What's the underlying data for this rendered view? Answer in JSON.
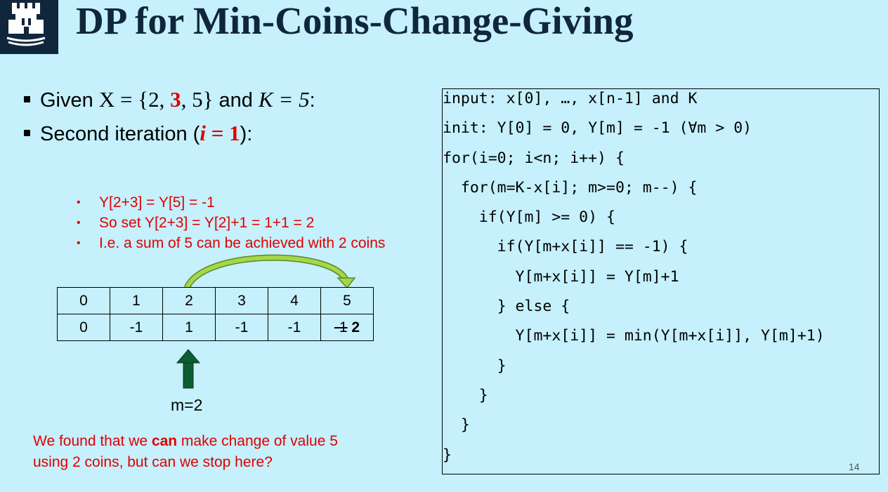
{
  "header": {
    "title": "DP for Min-Coins-Change-Giving"
  },
  "bullets": {
    "b1": {
      "lead": "Given ",
      "set_open": "X = {2, ",
      "set_red": "3",
      "set_close": ", 5}",
      "mid": " and ",
      "k": "K = 5",
      "end": ":"
    },
    "b2": {
      "lead": "Second iteration (",
      "i_var": "i",
      "i_rest": " = 1",
      "end": "):"
    }
  },
  "sub_bullets": [
    {
      "bullet": "•",
      "text": "Y[2+3] = Y[5] = -1"
    },
    {
      "bullet": "•",
      "text": "So set Y[2+3] = Y[2]+1 = 1+1 = 2"
    },
    {
      "bullet": "•",
      "text": "I.e. a sum of 5 can be achieved with 2 coins"
    }
  ],
  "array": {
    "indices": [
      "0",
      "1",
      "2",
      "3",
      "4",
      "5"
    ],
    "values": [
      "0",
      "-1",
      "1",
      "-1",
      "-1"
    ],
    "last_old": "-1",
    "last_new": "2"
  },
  "pointer_label": "m=2",
  "note": {
    "line1_pre": "We found that we ",
    "line1_bold": "can",
    "line1_post": " make change of value 5",
    "line2": "using 2 coins, but can we stop here?"
  },
  "code": [
    "input: x[0], …, x[n-1] and K",
    "init: Y[0] = 0, Y[m] = -1 (∀m > 0)",
    "for(i=0; i<n; i++) {",
    "  for(m=K-x[i]; m>=0; m--) {",
    "    if(Y[m] >= 0) {",
    "      if(Y[m+x[i]] == -1) {",
    "        Y[m+x[i]] = Y[m]+1",
    "      } else {",
    "        Y[m+x[i]] = min(Y[m+x[i]], Y[m]+1)",
    "      }",
    "    }",
    "  }",
    "}"
  ],
  "page_number": "14",
  "colors": {
    "title": "#10263b",
    "background": "#c5f0fc",
    "highlight": "#e00000",
    "pointer": "#0e5c32",
    "curve": "#8ec63f"
  }
}
